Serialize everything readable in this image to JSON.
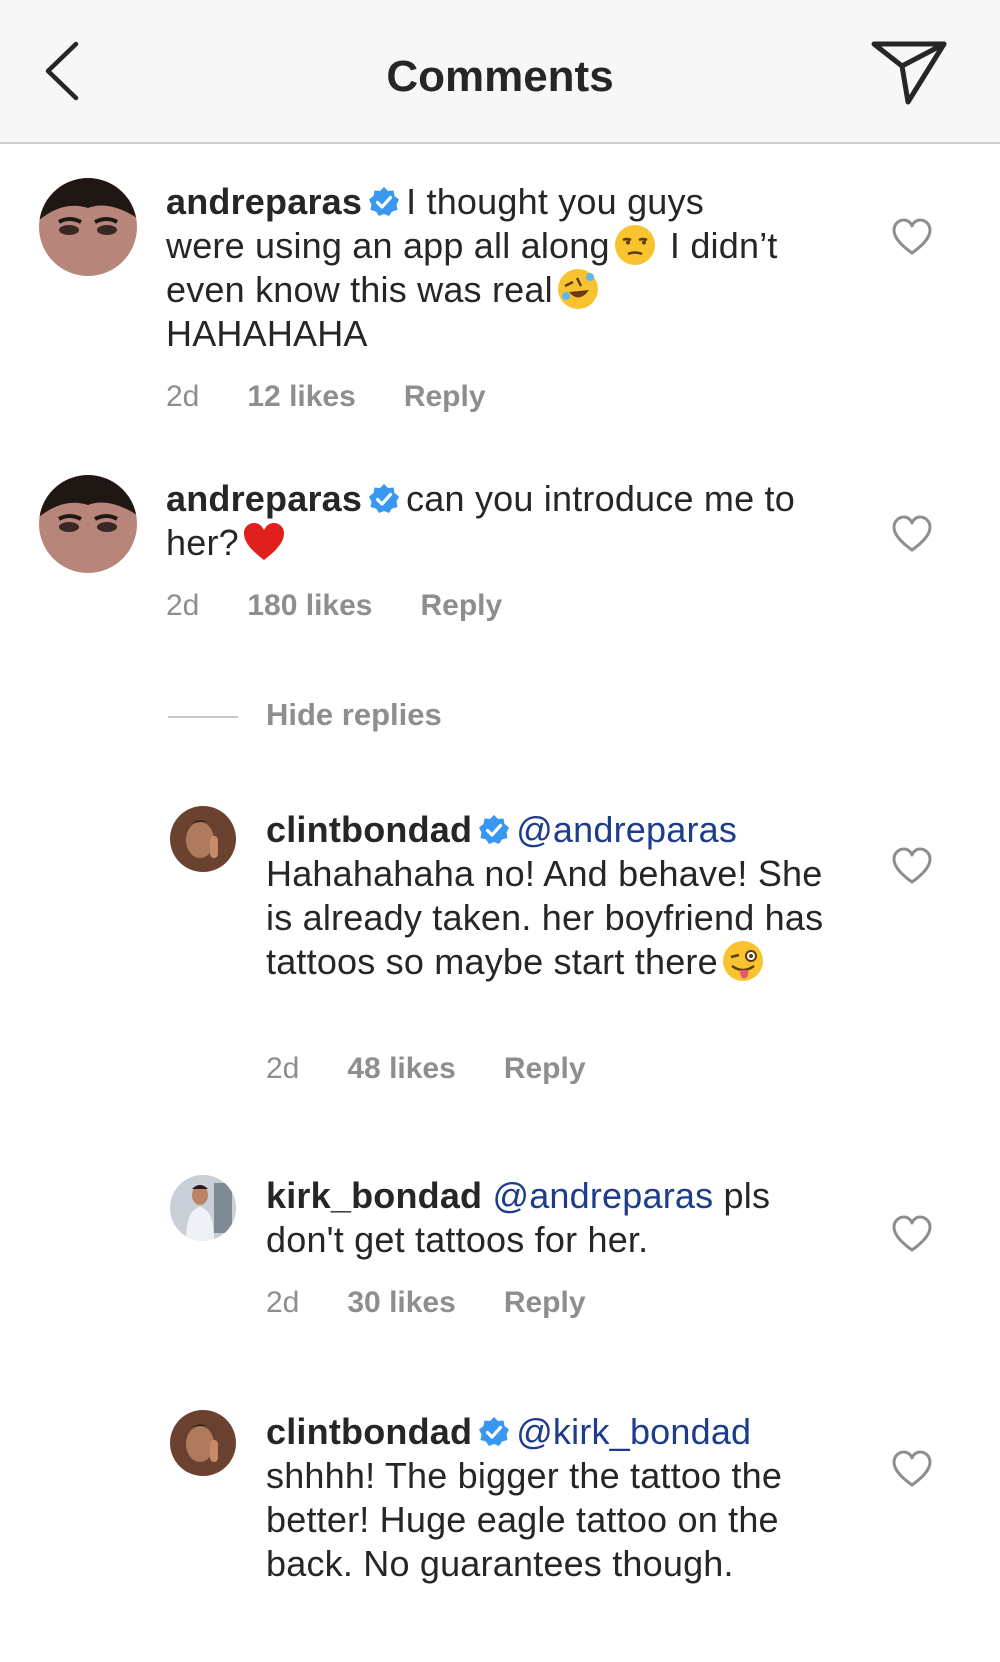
{
  "header": {
    "title": "Comments"
  },
  "comments": [
    {
      "username": "andreparas",
      "text_1": "I thought you guys were using an app all along",
      "text_2": "I didn’t even know this was real",
      "text_3": "HAHAHAHA",
      "time": "2d",
      "likes": "12 likes",
      "reply": "Reply"
    },
    {
      "username": "andreparas",
      "text_1": "can you introduce me to her?",
      "time": "2d",
      "likes": "180 likes",
      "reply": "Reply"
    }
  ],
  "hide_replies": "Hide replies",
  "replies": [
    {
      "username": "clintbondad",
      "mention": "@andreparas",
      "text_1": "Hahahahaha no! And behave! She is already taken. her boyfriend has tattoos so maybe start there",
      "time": "2d",
      "likes": "48 likes",
      "reply": "Reply"
    },
    {
      "username": "kirk_bondad",
      "mention": "@andreparas",
      "text_1": "pls don't get tattoos for her.",
      "time": "2d",
      "likes": "30 likes",
      "reply": "Reply"
    },
    {
      "username": "clintbondad",
      "mention": "@kirk_bondad",
      "text_1": "shhhh! The bigger the tattoo the better! Huge eagle tattoo on the back. No guarantees though."
    }
  ],
  "colors": {
    "verified": "#3897f0",
    "mention": "#1c3c8c",
    "muted": "#8e8e8e",
    "text": "#262626"
  },
  "icons": [
    "back-arrow-icon",
    "send-icon",
    "verified-badge-icon",
    "heart-icon",
    "unamused-emoji",
    "rofl-emoji",
    "red-heart-emoji",
    "winking-tongue-emoji"
  ]
}
